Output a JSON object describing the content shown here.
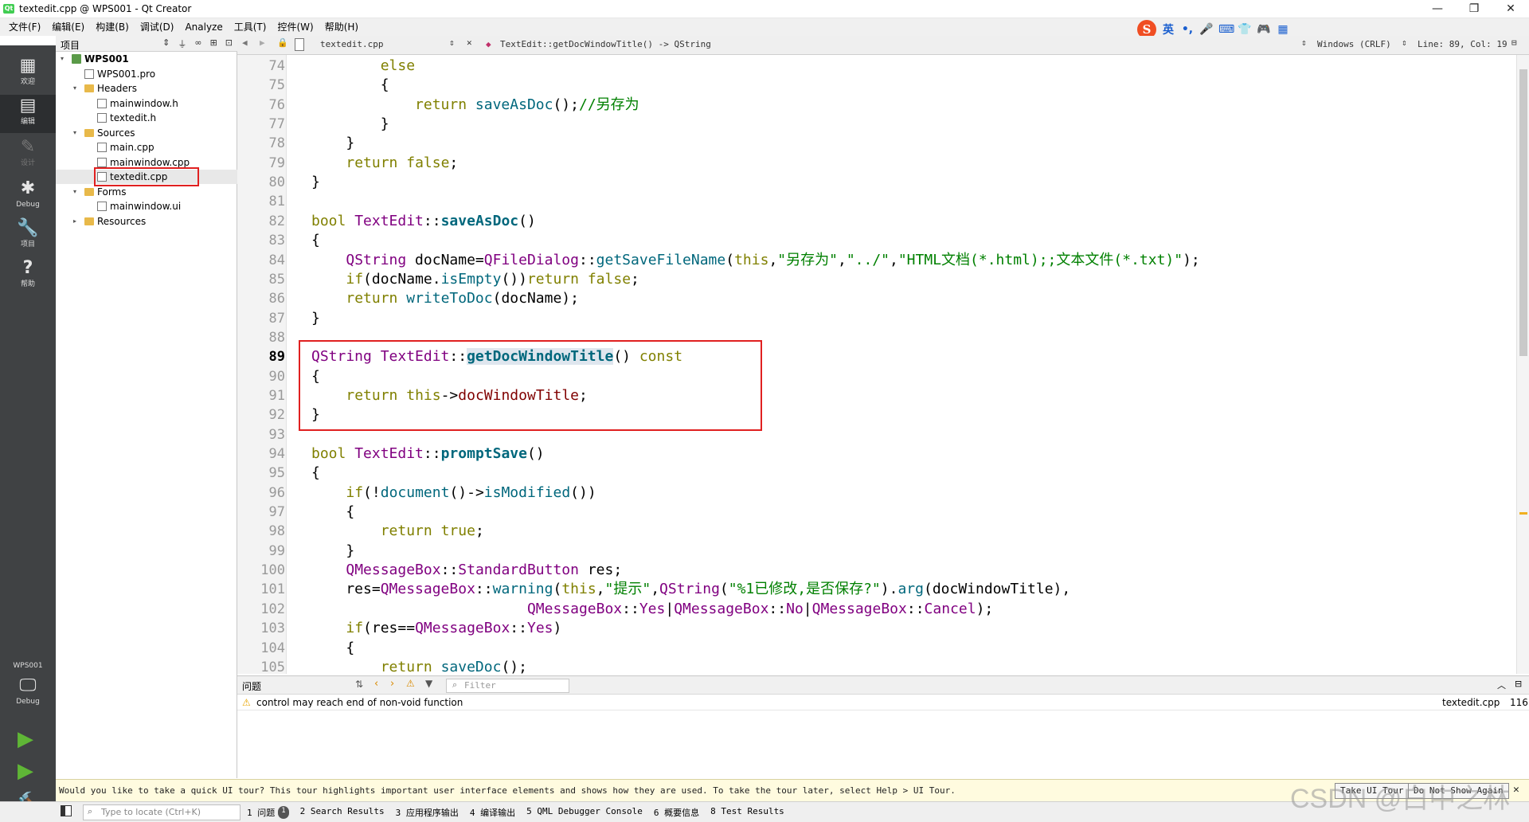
{
  "window": {
    "title": "textedit.cpp @ WPS001 - Qt Creator",
    "minimize": "—",
    "maximize": "❐",
    "close": "✕"
  },
  "menu": [
    "文件(F)",
    "编辑(E)",
    "构建(B)",
    "调试(D)",
    "Analyze",
    "工具(T)",
    "控件(W)",
    "帮助(H)"
  ],
  "ime": {
    "logo": "S",
    "lang": "英",
    "glyphs": [
      "•,",
      "🎤",
      "⌨",
      "👕",
      "🎮",
      "▦"
    ]
  },
  "modes": [
    {
      "icon": "grid-icon",
      "glyph": "▦",
      "label": "欢迎"
    },
    {
      "icon": "edit-icon",
      "glyph": "▤",
      "label": "编辑"
    },
    {
      "icon": "design-icon",
      "glyph": "✎",
      "label": "设计"
    },
    {
      "icon": "debug-icon",
      "glyph": "✱",
      "label": "Debug"
    },
    {
      "icon": "wrench-icon",
      "glyph": "🔧",
      "label": "项目"
    },
    {
      "icon": "help-icon",
      "glyph": "?",
      "label": "帮助"
    }
  ],
  "kit": {
    "project": "WPS001",
    "label": "Debug"
  },
  "project_panel": {
    "title": "项目",
    "tree": [
      {
        "label": "WPS001",
        "depth": 0,
        "type": "proj",
        "expanded": "▾",
        "bold": true
      },
      {
        "label": "WPS001.pro",
        "depth": 1,
        "type": "file",
        "expanded": ""
      },
      {
        "label": "Headers",
        "depth": 1,
        "type": "folder",
        "expanded": "▾"
      },
      {
        "label": "mainwindow.h",
        "depth": 2,
        "type": "file",
        "expanded": ""
      },
      {
        "label": "textedit.h",
        "depth": 2,
        "type": "file",
        "expanded": ""
      },
      {
        "label": "Sources",
        "depth": 1,
        "type": "folder",
        "expanded": "▾"
      },
      {
        "label": "main.cpp",
        "depth": 2,
        "type": "file",
        "expanded": ""
      },
      {
        "label": "mainwindow.cpp",
        "depth": 2,
        "type": "file",
        "expanded": ""
      },
      {
        "label": "textedit.cpp",
        "depth": 2,
        "type": "file",
        "expanded": "",
        "selected": true
      },
      {
        "label": "Forms",
        "depth": 1,
        "type": "folder",
        "expanded": "▾"
      },
      {
        "label": "mainwindow.ui",
        "depth": 2,
        "type": "file",
        "expanded": ""
      },
      {
        "label": "Resources",
        "depth": 1,
        "type": "folder",
        "expanded": "▸"
      }
    ]
  },
  "editor_toolbar": {
    "file": "textedit.cpp",
    "symbol": "TextEdit::getDocWindowTitle() -> QString",
    "line_ending": "Windows (CRLF)",
    "position": "Line: 89, Col: 19"
  },
  "code_lines": [
    {
      "n": "74",
      "fold": "▾",
      "parts": [
        {
          "t": "        "
        },
        {
          "t": "else",
          "c": "kw"
        }
      ]
    },
    {
      "n": "75",
      "fold": "",
      "parts": [
        {
          "t": "        {"
        }
      ]
    },
    {
      "n": "76",
      "fold": "",
      "parts": [
        {
          "t": "            "
        },
        {
          "t": "return",
          "c": "kw"
        },
        {
          "t": " "
        },
        {
          "t": "saveAsDoc",
          "c": "fn"
        },
        {
          "t": "();"
        },
        {
          "t": "//另存为",
          "c": "cm"
        }
      ]
    },
    {
      "n": "77",
      "fold": "",
      "parts": [
        {
          "t": "        }"
        }
      ]
    },
    {
      "n": "78",
      "fold": "",
      "parts": [
        {
          "t": "    }"
        }
      ]
    },
    {
      "n": "79",
      "fold": "",
      "parts": [
        {
          "t": "    "
        },
        {
          "t": "return",
          "c": "kw"
        },
        {
          "t": " "
        },
        {
          "t": "false",
          "c": "kw"
        },
        {
          "t": ";"
        }
      ]
    },
    {
      "n": "80",
      "fold": "",
      "parts": [
        {
          "t": "}"
        }
      ]
    },
    {
      "n": "81",
      "fold": "",
      "parts": [
        {
          "t": ""
        }
      ]
    },
    {
      "n": "82",
      "fold": "▾",
      "parts": [
        {
          "t": "bool",
          "c": "kw"
        },
        {
          "t": " "
        },
        {
          "t": "TextEdit",
          "c": "ty"
        },
        {
          "t": "::"
        },
        {
          "t": "saveAsDoc",
          "c": "fnb"
        },
        {
          "t": "()"
        }
      ]
    },
    {
      "n": "83",
      "fold": "",
      "parts": [
        {
          "t": "{"
        }
      ]
    },
    {
      "n": "84",
      "fold": "",
      "parts": [
        {
          "t": "    "
        },
        {
          "t": "QString",
          "c": "ty"
        },
        {
          "t": " docName="
        },
        {
          "t": "QFileDialog",
          "c": "ty"
        },
        {
          "t": "::"
        },
        {
          "t": "getSaveFileName",
          "c": "fn"
        },
        {
          "t": "("
        },
        {
          "t": "this",
          "c": "kw"
        },
        {
          "t": ","
        },
        {
          "t": "\"另存为\"",
          "c": "st"
        },
        {
          "t": ","
        },
        {
          "t": "\"../\"",
          "c": "st"
        },
        {
          "t": ","
        },
        {
          "t": "\"HTML文档(*.html);;文本文件(*.txt)\"",
          "c": "st"
        },
        {
          "t": ");"
        }
      ]
    },
    {
      "n": "85",
      "fold": "",
      "parts": [
        {
          "t": "    "
        },
        {
          "t": "if",
          "c": "kw"
        },
        {
          "t": "(docName."
        },
        {
          "t": "isEmpty",
          "c": "fn"
        },
        {
          "t": "())"
        },
        {
          "t": "return",
          "c": "kw"
        },
        {
          "t": " "
        },
        {
          "t": "false",
          "c": "kw"
        },
        {
          "t": ";"
        }
      ]
    },
    {
      "n": "86",
      "fold": "",
      "parts": [
        {
          "t": "    "
        },
        {
          "t": "return",
          "c": "kw"
        },
        {
          "t": " "
        },
        {
          "t": "writeToDoc",
          "c": "fn"
        },
        {
          "t": "(docName);"
        }
      ]
    },
    {
      "n": "87",
      "fold": "",
      "parts": [
        {
          "t": "}"
        }
      ]
    },
    {
      "n": "88",
      "fold": "",
      "parts": [
        {
          "t": ""
        }
      ]
    },
    {
      "n": "89",
      "fold": "▾",
      "current": true,
      "parts": [
        {
          "t": "QString",
          "c": "ty"
        },
        {
          "t": " "
        },
        {
          "t": "TextEdit",
          "c": "ty"
        },
        {
          "t": "::"
        },
        {
          "t": "getDocWindowTitle",
          "c": "fnb cur-hl"
        },
        {
          "t": "() "
        },
        {
          "t": "const",
          "c": "kw"
        }
      ]
    },
    {
      "n": "90",
      "fold": "",
      "parts": [
        {
          "t": "{"
        }
      ]
    },
    {
      "n": "91",
      "fold": "",
      "parts": [
        {
          "t": "    "
        },
        {
          "t": "return",
          "c": "kw"
        },
        {
          "t": " "
        },
        {
          "t": "this",
          "c": "kw"
        },
        {
          "t": "->"
        },
        {
          "t": "docWindowTitle",
          "c": "mem"
        },
        {
          "t": ";"
        }
      ]
    },
    {
      "n": "92",
      "fold": "",
      "parts": [
        {
          "t": "}"
        }
      ]
    },
    {
      "n": "93",
      "fold": "",
      "parts": [
        {
          "t": ""
        }
      ]
    },
    {
      "n": "94",
      "fold": "▾",
      "parts": [
        {
          "t": "bool",
          "c": "kw"
        },
        {
          "t": " "
        },
        {
          "t": "TextEdit",
          "c": "ty"
        },
        {
          "t": "::"
        },
        {
          "t": "promptSave",
          "c": "fnb"
        },
        {
          "t": "()"
        }
      ]
    },
    {
      "n": "95",
      "fold": "",
      "parts": [
        {
          "t": "{"
        }
      ]
    },
    {
      "n": "96",
      "fold": "▾",
      "parts": [
        {
          "t": "    "
        },
        {
          "t": "if",
          "c": "kw"
        },
        {
          "t": "(!"
        },
        {
          "t": "document",
          "c": "fn"
        },
        {
          "t": "()->"
        },
        {
          "t": "isModified",
          "c": "fn"
        },
        {
          "t": "())"
        }
      ]
    },
    {
      "n": "97",
      "fold": "",
      "parts": [
        {
          "t": "    {"
        }
      ]
    },
    {
      "n": "98",
      "fold": "",
      "parts": [
        {
          "t": "        "
        },
        {
          "t": "return",
          "c": "kw"
        },
        {
          "t": " "
        },
        {
          "t": "true",
          "c": "kw"
        },
        {
          "t": ";"
        }
      ]
    },
    {
      "n": "99",
      "fold": "",
      "parts": [
        {
          "t": "    }"
        }
      ]
    },
    {
      "n": "100",
      "fold": "",
      "parts": [
        {
          "t": "    "
        },
        {
          "t": "QMessageBox",
          "c": "ty"
        },
        {
          "t": "::"
        },
        {
          "t": "StandardButton",
          "c": "ty"
        },
        {
          "t": " res;"
        }
      ]
    },
    {
      "n": "101",
      "fold": "",
      "parts": [
        {
          "t": "    res="
        },
        {
          "t": "QMessageBox",
          "c": "ty"
        },
        {
          "t": "::"
        },
        {
          "t": "warning",
          "c": "fn"
        },
        {
          "t": "("
        },
        {
          "t": "this",
          "c": "kw"
        },
        {
          "t": ","
        },
        {
          "t": "\"提示\"",
          "c": "st"
        },
        {
          "t": ","
        },
        {
          "t": "QString",
          "c": "ty"
        },
        {
          "t": "("
        },
        {
          "t": "\"%1已修改,是否保存?\"",
          "c": "st"
        },
        {
          "t": ")."
        },
        {
          "t": "arg",
          "c": "fn"
        },
        {
          "t": "(docWindowTitle),"
        }
      ]
    },
    {
      "n": "102",
      "fold": "",
      "parts": [
        {
          "t": "                         "
        },
        {
          "t": "QMessageBox",
          "c": "ty"
        },
        {
          "t": "::"
        },
        {
          "t": "Yes",
          "c": "ty"
        },
        {
          "t": "|"
        },
        {
          "t": "QMessageBox",
          "c": "ty"
        },
        {
          "t": "::"
        },
        {
          "t": "No",
          "c": "ty"
        },
        {
          "t": "|"
        },
        {
          "t": "QMessageBox",
          "c": "ty"
        },
        {
          "t": "::"
        },
        {
          "t": "Cancel",
          "c": "ty"
        },
        {
          "t": ");"
        }
      ]
    },
    {
      "n": "103",
      "fold": "▾",
      "parts": [
        {
          "t": "    "
        },
        {
          "t": "if",
          "c": "kw"
        },
        {
          "t": "(res=="
        },
        {
          "t": "QMessageBox",
          "c": "ty"
        },
        {
          "t": "::"
        },
        {
          "t": "Yes",
          "c": "ty"
        },
        {
          "t": ")"
        }
      ]
    },
    {
      "n": "104",
      "fold": "",
      "parts": [
        {
          "t": "    {"
        }
      ]
    },
    {
      "n": "105",
      "fold": "",
      "parts": [
        {
          "t": "        "
        },
        {
          "t": "return",
          "c": "kw"
        },
        {
          "t": " "
        },
        {
          "t": "saveDoc",
          "c": "fn"
        },
        {
          "t": "();"
        }
      ]
    }
  ],
  "issues": {
    "title": "问题",
    "filter_placeholder": "Filter",
    "row": {
      "message": "control may reach end of non-void function",
      "file": "textedit.cpp",
      "line": "116"
    }
  },
  "tour": {
    "message": "Would you like to take a quick UI tour? This tour highlights important user interface elements and shows how they are used. To take the tour later, select Help > UI Tour.",
    "take_label": "Take UI Tour",
    "dismiss_label": "Do Not Show Again"
  },
  "statusbar": {
    "locate_placeholder": "Type to locate (Ctrl+K)",
    "tabs": [
      "1 问题",
      "2 Search Results",
      "3 应用程序输出",
      "4 编译输出",
      "5 QML Debugger Console",
      "6 概要信息",
      "8 Test Results"
    ],
    "issue_count": "1"
  },
  "watermark": "CSDN @白中之林"
}
